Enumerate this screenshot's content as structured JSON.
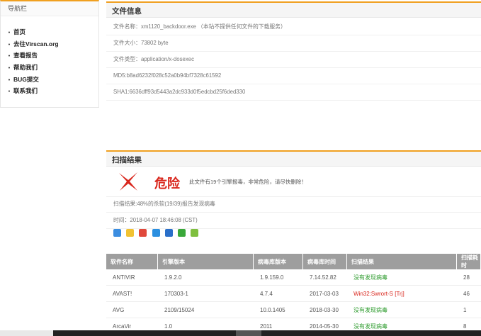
{
  "sidebar": {
    "title": "导航栏",
    "items": [
      {
        "label": "首页"
      },
      {
        "label": "去往Virscan.org"
      },
      {
        "label": "查看报告"
      },
      {
        "label": "帮助我们"
      },
      {
        "label": "BUG提交"
      },
      {
        "label": "联系我们"
      }
    ]
  },
  "file_info": {
    "title": "文件信息",
    "name": "文件名称：xm1120_backdoor.exe （本站不提供任何文件的下载服务）",
    "size": "文件大小：73802 byte",
    "type": "文件类型：application/x-dosexec",
    "md5": "MD5:b8ad6232f028c52a0b94bf7328c61592",
    "sha1": "SHA1:6636dff93d5443a2dc933d0f5edcbd25f6ded330"
  },
  "scan": {
    "title": "扫描结果",
    "verdict": "危险",
    "verdict_desc": "此文件有19个引擎报毒，非常危险，请尽快删除！",
    "summary": "扫描结果:48%的杀软(19/39)报告发现病毒",
    "time": "时间：2018-04-07 18:46:08 (CST)",
    "colors": {
      "danger": "#d9261c",
      "ok": "#2a9a2a",
      "accent": "#f0a020"
    }
  },
  "share_icons": [
    "qzone-icon",
    "star-icon",
    "weibo-icon",
    "baidu-icon",
    "renren-icon",
    "wechat-icon",
    "more-icon"
  ],
  "table": {
    "headers": [
      "软件名称",
      "引擎版本",
      "病毒库版本",
      "病毒库时间",
      "扫描结果",
      "扫描耗时"
    ],
    "rows": [
      {
        "name": "ANTIVIR",
        "engine": "1.9.2.0",
        "db": "1.9.159.0",
        "db_time": "7.14.52.82",
        "result": "没有发现病毒",
        "status": "ok",
        "time": "28"
      },
      {
        "name": "AVAST!",
        "engine": "170303-1",
        "db": "4.7.4",
        "db_time": "2017-03-03",
        "result": "Win32:Swrort-S [Trj]",
        "status": "bad",
        "time": "46"
      },
      {
        "name": "AVG",
        "engine": "2109/15024",
        "db": "10.0.1405",
        "db_time": "2018-03-30",
        "result": "没有发现病毒",
        "status": "ok",
        "time": "1"
      },
      {
        "name": "ArcaVir",
        "engine": "1.0",
        "db": "2011",
        "db_time": "2014-05-30",
        "result": "没有发现病毒",
        "status": "ok",
        "time": "8"
      }
    ]
  }
}
